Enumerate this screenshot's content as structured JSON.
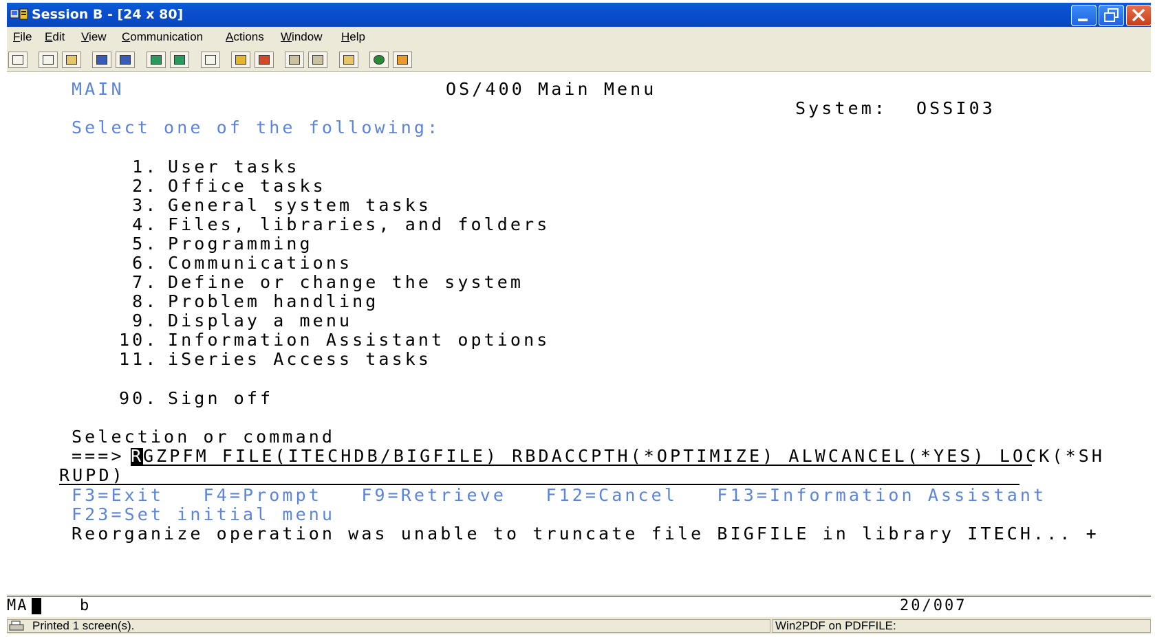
{
  "window": {
    "title": "Session B - [24 x 80]"
  },
  "menubar": {
    "items": [
      {
        "label": "File",
        "key": "F"
      },
      {
        "label": "Edit",
        "key": "E"
      },
      {
        "label": "View",
        "key": "V"
      },
      {
        "label": "Communication",
        "key": "C"
      },
      {
        "label": "Actions",
        "key": "A"
      },
      {
        "label": "Window",
        "key": "W"
      },
      {
        "label": "Help",
        "key": "H"
      }
    ]
  },
  "toolbar": {
    "buttons": [
      "print-screen",
      "copy",
      "paste",
      "send-file",
      "receive-file",
      "display-macro",
      "play-macro",
      "record-macro",
      "start-macro",
      "stop-macro",
      "customize",
      "settings",
      "clipboard",
      "help",
      "find"
    ]
  },
  "terminal": {
    "menu_id": "MAIN",
    "title": "OS/400 Main Menu",
    "system_label": "System:",
    "system_name": "OSSI03",
    "prompt": "Select one of the following:",
    "options": [
      {
        "num": " 1.",
        "label": "User tasks"
      },
      {
        "num": " 2.",
        "label": "Office tasks"
      },
      {
        "num": " 3.",
        "label": "General system tasks"
      },
      {
        "num": " 4.",
        "label": "Files, libraries, and folders"
      },
      {
        "num": " 5.",
        "label": "Programming"
      },
      {
        "num": " 6.",
        "label": "Communications"
      },
      {
        "num": " 7.",
        "label": "Define or change the system"
      },
      {
        "num": " 8.",
        "label": "Problem handling"
      },
      {
        "num": " 9.",
        "label": "Display a menu"
      },
      {
        "num": "10.",
        "label": "Information Assistant options"
      },
      {
        "num": "11.",
        "label": "iSeries Access tasks"
      }
    ],
    "signoff": {
      "num": "90.",
      "label": "Sign off"
    },
    "selection_label": "Selection or command",
    "arrow": "===>",
    "cursor_char": "R",
    "command_line1": "GZPFM FILE(ITECHDB/BIGFILE) RBDACCPTH(*OPTIMIZE) ALWCANCEL(*YES) LOCK(*SH",
    "command_line2": "RUPD)",
    "fkeys_line1": "F3=Exit   F4=Prompt   F9=Retrieve   F12=Cancel   F13=Information Assistant",
    "fkeys_line2": "F23=Set initial menu",
    "message": "Reorganize operation was unable to truncate file BIGFILE in library ITECH... +"
  },
  "oia": {
    "mode": "MA",
    "indicator": "b",
    "position": "20/007"
  },
  "statusbar": {
    "left": "Printed 1 screen(s).",
    "right": "Win2PDF on PDFFILE:"
  }
}
